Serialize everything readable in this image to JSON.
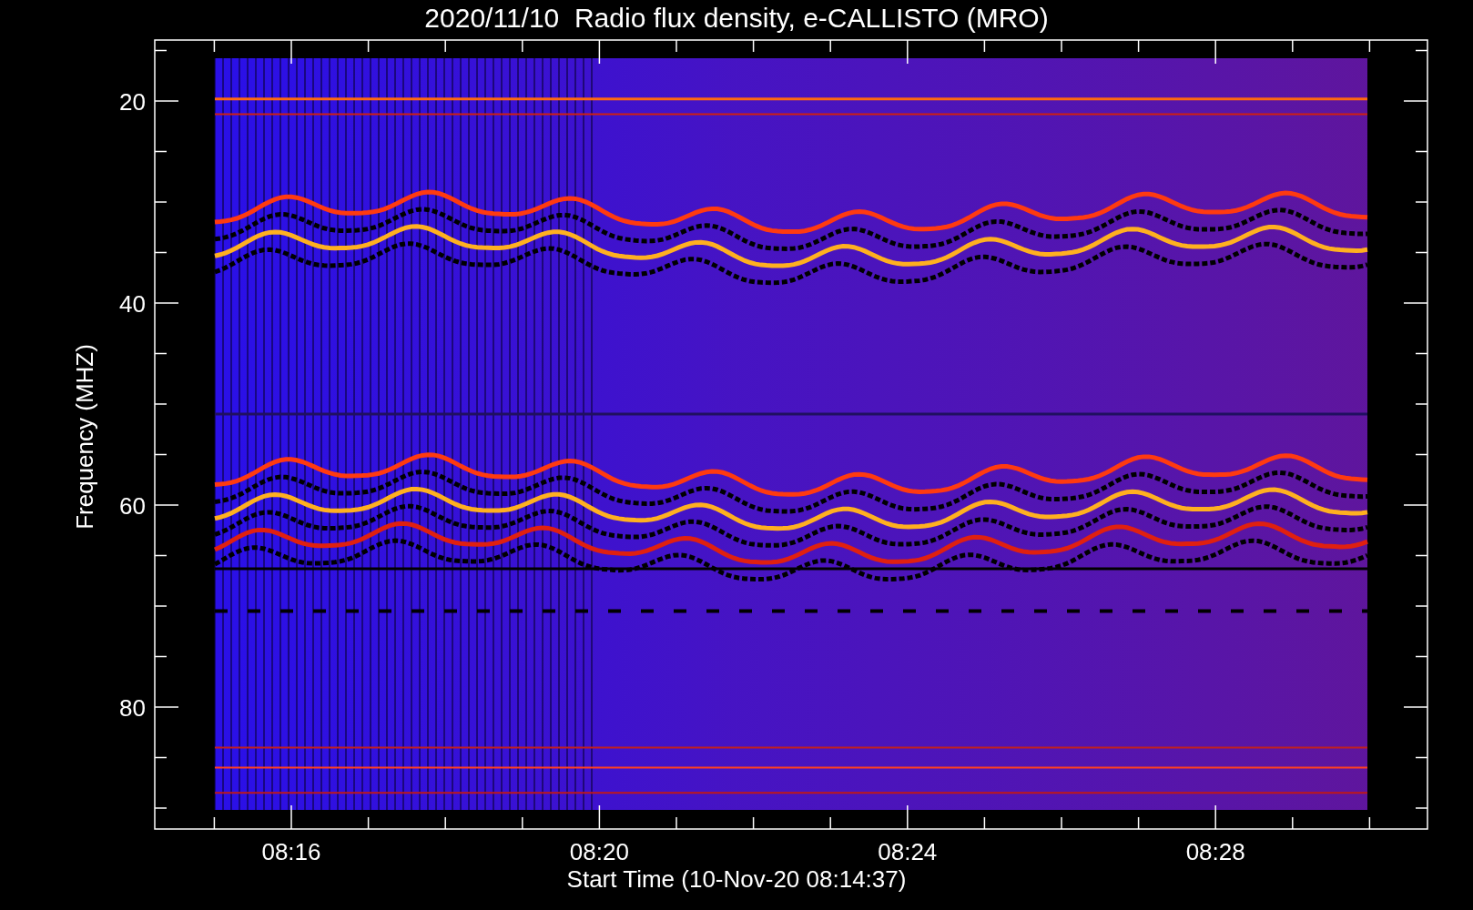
{
  "title": "2020/11/10  Radio flux density, e-CALLISTO (MRO)",
  "y_axis": {
    "title": "Frequency (MHZ)",
    "tick_labels": [
      "20",
      "40",
      "60",
      "80"
    ]
  },
  "x_axis": {
    "title": "Start Time (10-Nov-20 08:14:37)",
    "tick_labels": [
      "08:16",
      "08:20",
      "08:24",
      "08:28"
    ]
  }
}
